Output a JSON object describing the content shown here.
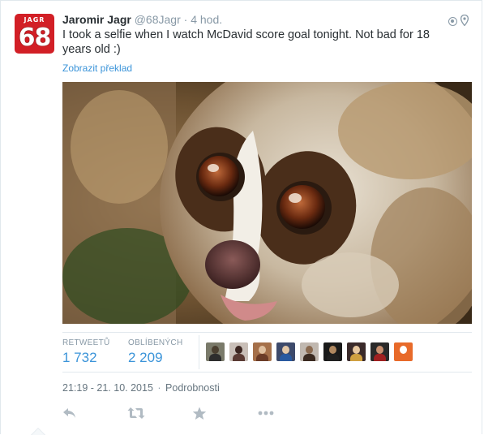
{
  "tweet": {
    "avatar_top": "JAGR",
    "avatar_number": "68",
    "fullname": "Jaromir Jagr",
    "username": "@68Jagr",
    "separator": "·",
    "relative_time": "4 hod.",
    "text": "I took a selfie when I watch McDavid score goal tonight. Not bad for 18 years old :)",
    "translate_label": "Zobrazit překlad",
    "photo_icon": "slow-loris-photo"
  },
  "stats": {
    "retweets_label": "RETWEETŮ",
    "retweets_value": "1 732",
    "favorites_label": "OBLÍBENÝCH",
    "favorites_value": "2 209"
  },
  "favoriters": [
    {
      "bg": "#7a7a6a",
      "face": "#4a3f30",
      "body": "#2d2d2d"
    },
    {
      "bg": "#c9bfb8",
      "face": "#3b2520",
      "body": "#5a3a33"
    },
    {
      "bg": "#a5704a",
      "face": "#e0c0a0",
      "body": "#6b3c28"
    },
    {
      "bg": "#3d4a6b",
      "face": "#e4c8a8",
      "body": "#2a5aa0"
    },
    {
      "bg": "#c0b8b0",
      "face": "#8a6a50",
      "body": "#3a2a20"
    },
    {
      "bg": "#1a1a1a",
      "face": "#b08860",
      "body": "#202020"
    },
    {
      "bg": "#3a2a2a",
      "face": "#e8c8a0",
      "body": "#d0a040"
    },
    {
      "bg": "#2a2a2a",
      "face": "#c89070",
      "body": "#a02020"
    },
    {
      "bg": "#e86a2a",
      "face": "#ffffff",
      "body": "#e86a2a"
    }
  ],
  "meta": {
    "timestamp": "21:19 - 21. 10. 2015",
    "separator": "·",
    "details_link": "Podrobnosti"
  },
  "actions": {
    "reply_icon": "reply-icon",
    "retweet_icon": "retweet-icon",
    "favorite_icon": "star-icon",
    "more_icon": "more-icon"
  },
  "colors": {
    "link": "#3b94d9",
    "muted": "#8899a6",
    "text": "#292f33",
    "brand_red": "#d21f26"
  }
}
